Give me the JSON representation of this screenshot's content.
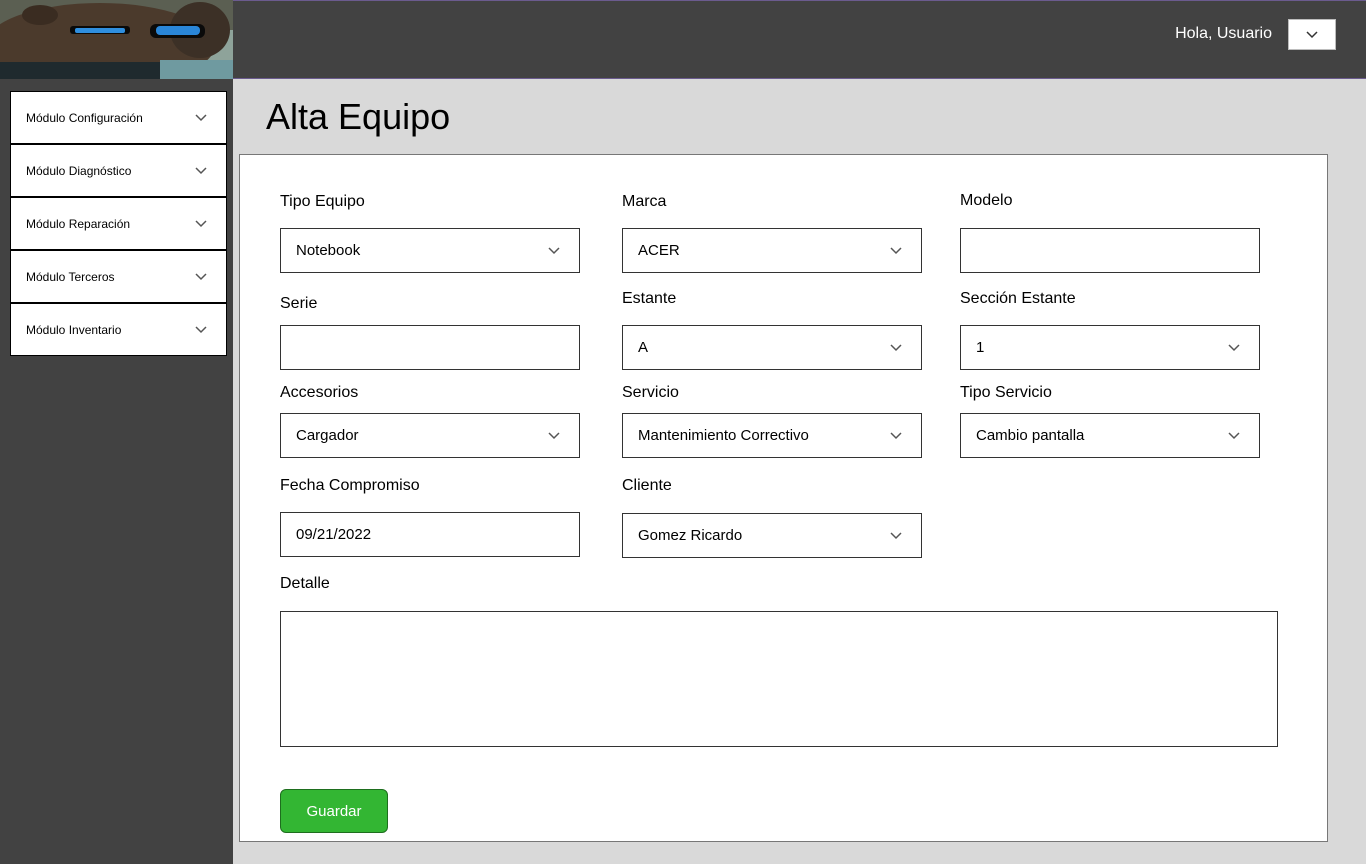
{
  "header": {
    "greeting": "Hola, Usuario",
    "user_menu_icon": "chevron-down-icon"
  },
  "sidebar": {
    "items": [
      {
        "label": "Módulo Configuración"
      },
      {
        "label": "Módulo Diagnóstico"
      },
      {
        "label": "Módulo Reparación"
      },
      {
        "label": "Módulo Terceros"
      },
      {
        "label": "Módulo Inventario"
      }
    ]
  },
  "page": {
    "title": "Alta Equipo"
  },
  "form": {
    "tipo_equipo": {
      "label": "Tipo Equipo",
      "value": "Notebook"
    },
    "marca": {
      "label": "Marca",
      "value": "ACER"
    },
    "modelo": {
      "label": "Modelo",
      "value": ""
    },
    "serie": {
      "label": "Serie",
      "value": ""
    },
    "estante": {
      "label": "Estante",
      "value": "A"
    },
    "seccion_estante": {
      "label": "Sección Estante",
      "value": "1"
    },
    "accesorios": {
      "label": "Accesorios",
      "value": "Cargador"
    },
    "servicio": {
      "label": "Servicio",
      "value": "Mantenimiento Correctivo"
    },
    "tipo_servicio": {
      "label": "Tipo Servicio",
      "value": "Cambio pantalla"
    },
    "fecha_compromiso": {
      "label": "Fecha Compromiso",
      "value": "09/21/2022"
    },
    "cliente": {
      "label": "Cliente",
      "value": "Gomez Ricardo"
    },
    "detalle": {
      "label": "Detalle",
      "value": ""
    },
    "save_label": "Guardar"
  },
  "colors": {
    "topbar": "#424242",
    "sidebar": "#424242",
    "background": "#d9d9d9",
    "save_button": "#33b633"
  }
}
